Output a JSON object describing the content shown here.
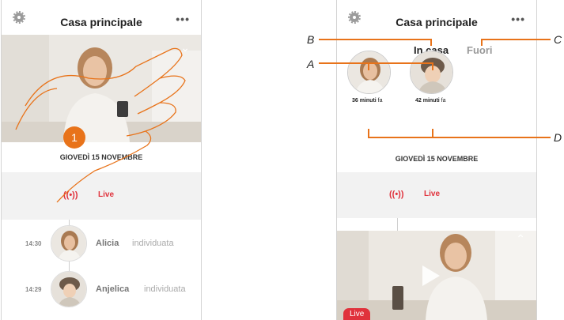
{
  "left_screen": {
    "title": "Casa principale",
    "more_label": "•••",
    "date": "GIOVEDÌ 15 NOVEMBRE",
    "live_label": "Live",
    "step_number": "1",
    "events": [
      {
        "time": "14:30",
        "name": "Alicia",
        "action": "individuata"
      },
      {
        "time": "14:29",
        "name": "Anjelica",
        "action": "individuata"
      }
    ]
  },
  "right_screen": {
    "title": "Casa principale",
    "more_label": "•••",
    "tabs": [
      "In casa",
      "Fuori"
    ],
    "people": [
      {
        "minutes": "36 minuti",
        "suffix": " fa"
      },
      {
        "minutes": "42 minuti",
        "suffix": " fa"
      }
    ],
    "date": "GIOVEDÌ 15 NOVEMBRE",
    "live_label": "Live",
    "live_badge": "Live"
  },
  "callouts": {
    "a": "A",
    "b": "B",
    "c": "C",
    "d": "D"
  },
  "colors": {
    "accent_orange": "#e8731a",
    "live_red": "#e0323c"
  }
}
